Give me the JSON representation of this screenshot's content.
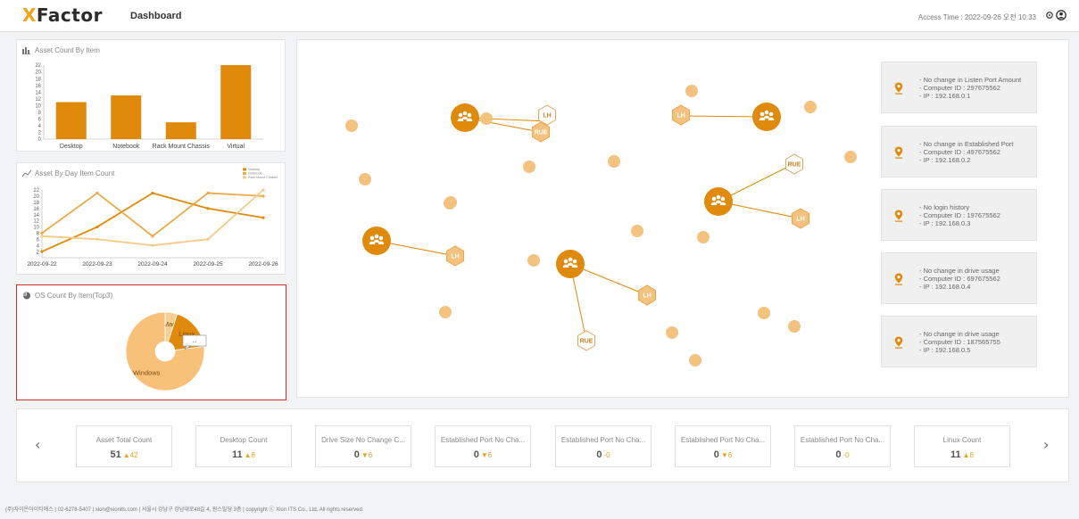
{
  "header": {
    "logo_prefix": "X",
    "logo_rest": "Factor",
    "page_title": "Dashboard",
    "access_time": "Access Time : 2022-09-26 오전 10:33"
  },
  "asset_count_panel": {
    "title": "Asset Count By Item",
    "chart_data": {
      "type": "bar",
      "categories": [
        "Desktop",
        "Notebook",
        "Rack Mount Chassis",
        "Virtual"
      ],
      "values": [
        11,
        13,
        5,
        22
      ],
      "ylim": [
        0,
        22
      ],
      "yticks": [
        "0",
        "2",
        "4",
        "6",
        "8",
        "10",
        "12",
        "14",
        "16",
        "18",
        "20",
        "22"
      ],
      "color": "#e08a0b"
    }
  },
  "day_count_panel": {
    "title": "Asset By Day Item Count",
    "chart_data": {
      "type": "line",
      "x": [
        "2022-09-22",
        "2022-09-23",
        "2022-09-24",
        "2022-09-25",
        "2022-09-26"
      ],
      "ylim": [
        0,
        22
      ],
      "yticks": [
        "2",
        "4",
        "6",
        "8",
        "10",
        "12",
        "14",
        "16",
        "18",
        "20",
        "22"
      ],
      "legend": "top-right",
      "series": [
        {
          "name": "Desktop",
          "values": [
            2,
            10,
            21,
            16,
            13
          ],
          "color": "#e08a0b"
        },
        {
          "name": "Notebook",
          "values": [
            8,
            21,
            7,
            21,
            20
          ],
          "color": "#eba948"
        },
        {
          "name": "Rack Mount Chassis",
          "values": [
            7,
            6,
            4,
            6,
            22
          ],
          "color": "#f5c987"
        }
      ]
    }
  },
  "os_panel": {
    "title": "OS Count By Item(Top3)",
    "chart_data": {
      "type": "pie",
      "labels": [
        "Mac",
        "Linux",
        "Windows"
      ],
      "values": [
        5,
        18,
        77
      ],
      "colors": [
        "#f7cf92",
        "#e08a0b",
        "#f7c17a"
      ]
    },
    "tooltip": "..."
  },
  "network": {
    "labels": {
      "lh": "LH",
      "rue": "RUE"
    },
    "orange": "#e08a0b",
    "node_color": "#f3c27f"
  },
  "alerts": [
    {
      "line1": "- No change in Listen Port Amount",
      "line2": "- Computer ID : 297675562",
      "line3": "- IP : 192.168.0.1"
    },
    {
      "line1": "- No change in Established Port",
      "line2": "- Computer ID : 497675562",
      "line3": "- IP : 192.168.0.2"
    },
    {
      "line1": "- No login history",
      "line2": "- Computer ID : 197675562",
      "line3": "- IP : 192.168.0.3"
    },
    {
      "line1": "- No change in drive usage",
      "line2": "- Computer ID : 697675562",
      "line3": "- IP : 192.168.0.4"
    },
    {
      "line1": "- No change in drive usage",
      "line2": "- Computer ID : 187565755",
      "line3": "- IP : 192.168.0.5"
    }
  ],
  "cards": [
    {
      "label": "Asset Total Count",
      "value": "51",
      "arrow": "▲",
      "delta": "42"
    },
    {
      "label": "Desktop Count",
      "value": "11",
      "arrow": "▲",
      "delta": "8"
    },
    {
      "label": "Drive Size No Change C...",
      "value": "0",
      "arrow": "▼",
      "delta": "6"
    },
    {
      "label": "Established Port No Cha...",
      "value": "0",
      "arrow": "▼",
      "delta": "6"
    },
    {
      "label": "Established Port No Cha...",
      "value": "0",
      "arrow": "-",
      "delta": "0"
    },
    {
      "label": "Established Port No Cha...",
      "value": "0",
      "arrow": "▼",
      "delta": "6"
    },
    {
      "label": "Established Port No Cha...",
      "value": "0",
      "arrow": "-",
      "delta": "0"
    },
    {
      "label": "Linux Count",
      "value": "11",
      "arrow": "▲",
      "delta": "8"
    }
  ],
  "nav": {
    "prev": "‹",
    "next": "›"
  },
  "footer": "(주)자이온아이티에스 | 02-6278-5407 | xion@xionits.com | 서울시 강남구 강남대로48길 4, 원스빌딩 3층 | copyright ⓒ Xion ITS Co., Ltd. All rights reserved."
}
